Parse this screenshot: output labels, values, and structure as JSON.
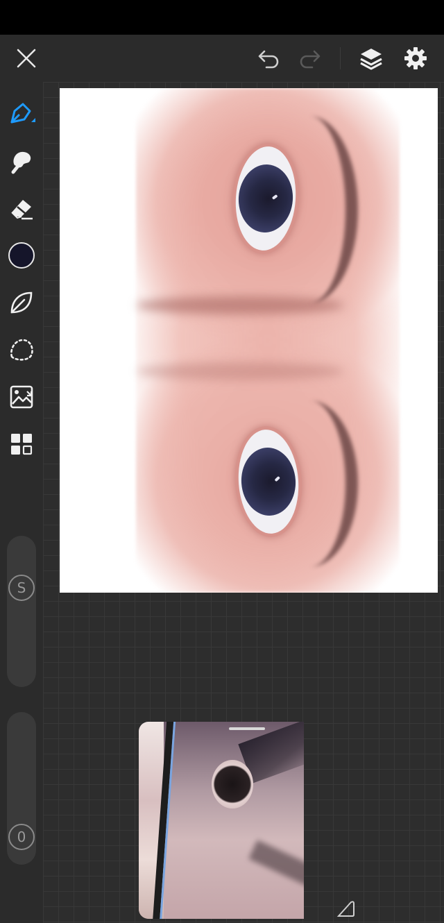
{
  "app": {
    "name": "drawing-app",
    "accent_color": "#1e9bff"
  },
  "top_bar": {
    "icons": [
      "close-icon",
      "undo-icon",
      "redo-icon",
      "layers-icon",
      "gear-icon"
    ]
  },
  "toolbar": {
    "tools": [
      "pen-tool-icon",
      "smudge-tool-icon",
      "eraser-tool-icon",
      "color-swatch",
      "leaf-shape-icon",
      "lasso-select-icon",
      "image-import-icon",
      "grid-layout-icon"
    ],
    "current_color": "#15152a",
    "size_slider_label": "S",
    "opacity_slider_label": "0"
  },
  "reference_panel": {
    "visible": true
  }
}
